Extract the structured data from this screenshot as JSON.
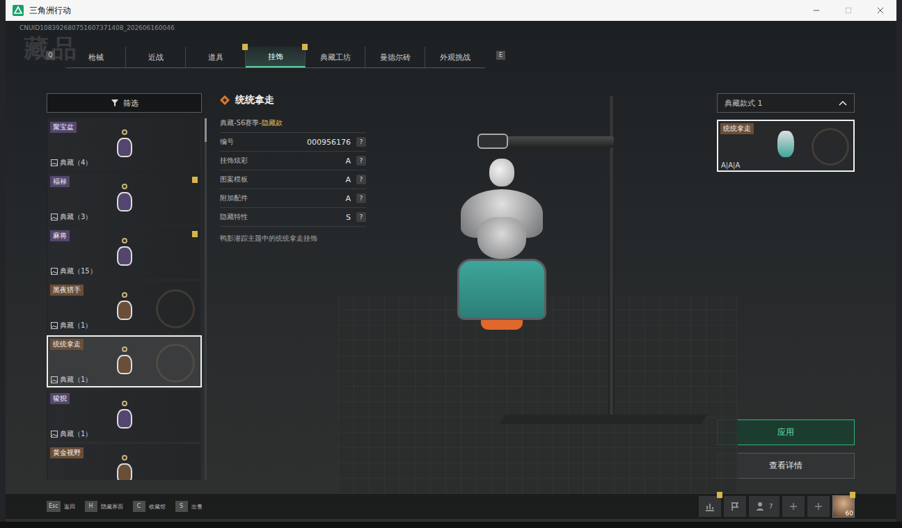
{
  "window": {
    "title": "三角洲行动"
  },
  "uid": "CNUID108392680751607371408_202606160046",
  "page_title": "藏品",
  "tab_keys": {
    "prev": "Q",
    "next": "E"
  },
  "tabs": [
    {
      "label": "枪械",
      "selected": false,
      "alert": false
    },
    {
      "label": "近战",
      "selected": false,
      "alert": false
    },
    {
      "label": "道具",
      "selected": false,
      "alert": true
    },
    {
      "label": "挂饰",
      "selected": true,
      "alert": true
    },
    {
      "label": "典藏工坊",
      "selected": false,
      "alert": false
    },
    {
      "label": "曼德尔砖",
      "selected": false,
      "alert": false
    },
    {
      "label": "外观挑战",
      "selected": false,
      "alert": false
    }
  ],
  "filter": {
    "label": "筛选"
  },
  "items": [
    {
      "name": "聚宝盆",
      "count": "典藏（4）",
      "selected": false,
      "alert": false,
      "emblem": false,
      "color": "#54456e"
    },
    {
      "name": "福禄",
      "count": "典藏（3）",
      "selected": false,
      "alert": true,
      "emblem": false,
      "color": "#54456e"
    },
    {
      "name": "麻将",
      "count": "典藏（15）",
      "selected": false,
      "alert": true,
      "emblem": false,
      "color": "#54456e"
    },
    {
      "name": "黑夜猎手",
      "count": "典藏（1）",
      "selected": false,
      "alert": false,
      "emblem": true,
      "color": "#6a4e38"
    },
    {
      "name": "统统拿走",
      "count": "典藏（1）",
      "selected": true,
      "alert": false,
      "emblem": true,
      "color": "#6a4e38"
    },
    {
      "name": "狻猊",
      "count": "典藏（1）",
      "selected": false,
      "alert": false,
      "emblem": false,
      "color": "#54456e"
    },
    {
      "name": "黄金视野",
      "count": "",
      "selected": false,
      "alert": false,
      "emblem": false,
      "color": "#6a4e38"
    }
  ],
  "detail": {
    "title": "统统拿走",
    "series": "典藏-S6赛季-",
    "rarity": "隐藏款",
    "help": "?",
    "rows": [
      {
        "label": "编号",
        "value": "000956176"
      },
      {
        "label": "挂饰炫彩",
        "value": "A"
      },
      {
        "label": "图案模板",
        "value": "A"
      },
      {
        "label": "附加配件",
        "value": "A"
      },
      {
        "label": "隐藏特性",
        "value": "S"
      }
    ],
    "description": "鸭影潜踪主题中的统统拿走挂饰"
  },
  "variant": {
    "label": "典藏款式 1",
    "expanded": true,
    "cards": [
      {
        "name": "统统拿走",
        "grades": "A|A|A",
        "selected": true
      }
    ]
  },
  "actions": [
    {
      "label": "应用",
      "kind": "primary"
    },
    {
      "label": "查看详情",
      "kind": "secondary"
    }
  ],
  "hotkeys": [
    {
      "key": "Esc",
      "label": "返回"
    },
    {
      "key": "H",
      "label": "隐藏界面"
    },
    {
      "key": "C",
      "label": "收藏馆"
    },
    {
      "key": "S",
      "label": "出售"
    }
  ],
  "status": {
    "stats_alert": true,
    "friends": "7",
    "level": "60",
    "avatar_alert": true
  }
}
